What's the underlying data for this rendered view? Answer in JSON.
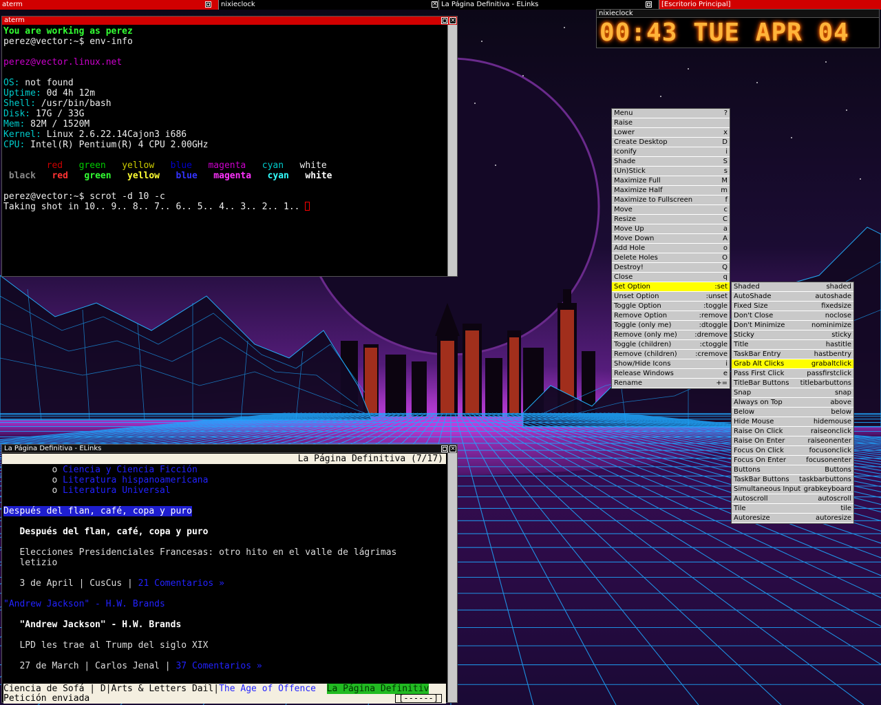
{
  "taskbar": {
    "items": [
      {
        "label": "aterm",
        "state": "active"
      },
      {
        "label": "nixieclock",
        "state": "normal"
      },
      {
        "label": "La Página Definitiva - ELinks",
        "state": "normal"
      },
      {
        "label": "[Escritorio Principal]",
        "state": "active"
      }
    ]
  },
  "aterm": {
    "title": "aterm",
    "welcome": "You are working as perez",
    "prompt1": "perez@vector:~$ env-info",
    "hostline": "perez@vector.linux.net",
    "os_label": "OS:",
    "os_value": " not found",
    "uptime_label": "Uptime:",
    "uptime_value": " 0d 4h 12m",
    "shell_label": "Shell:",
    "shell_value": " /usr/bin/bash",
    "disk_label": "Disk:",
    "disk_value": " 17G / 33G",
    "mem_label": "Mem:",
    "mem_value": " 82M / 1520M",
    "kernel_label": "Kernel:",
    "kernel_value": " Linux 2.6.22.14Cajon3 i686",
    "cpu_label": "CPU:",
    "cpu_value": " Intel(R) Pentium(R) 4 CPU 2.00GHz",
    "colors_normal": [
      "red",
      "green",
      "yellow",
      "blue",
      "magenta",
      "cyan",
      "white"
    ],
    "colors_bold": [
      "black",
      "red",
      "green",
      "yellow",
      "blue",
      "magenta",
      "cyan",
      "white"
    ],
    "prompt2": "perez@vector:~$ scrot -d 10 -c",
    "shot_line": "Taking shot in 10.. 9.. 8.. 7.. 6.. 5.. 4.. 3.. 2.. 1.. "
  },
  "nixieclock": {
    "title": "nixieclock",
    "time": "00:43",
    "day": "TUE",
    "month": "APR",
    "date": "04"
  },
  "window_menu": {
    "items": [
      {
        "label": "Menu",
        "key": "?"
      },
      {
        "label": "Raise",
        "key": ""
      },
      {
        "label": "Lower",
        "key": "x"
      },
      {
        "label": "Create Desktop",
        "key": "D"
      },
      {
        "label": "Iconify",
        "key": "i"
      },
      {
        "label": "Shade",
        "key": "S"
      },
      {
        "label": "(Un)Stick",
        "key": "s"
      },
      {
        "label": "Maximize Full",
        "key": "M"
      },
      {
        "label": "Maximize Half",
        "key": "m"
      },
      {
        "label": "Maximize to Fullscreen",
        "key": "f"
      },
      {
        "label": "Move",
        "key": "c"
      },
      {
        "label": "Resize",
        "key": "C"
      },
      {
        "label": "Move Up",
        "key": "a"
      },
      {
        "label": "Move Down",
        "key": "A"
      },
      {
        "label": "Add Hole",
        "key": "o"
      },
      {
        "label": "Delete Holes",
        "key": "O"
      },
      {
        "label": "Destroy!",
        "key": "Q"
      },
      {
        "label": "Close",
        "key": "q"
      },
      {
        "label": "Set Option",
        "key": ":set",
        "selected": true
      },
      {
        "label": "Unset Option",
        "key": ":unset"
      },
      {
        "label": "Toggle Option",
        "key": ":toggle"
      },
      {
        "label": "Remove Option",
        "key": ":remove"
      },
      {
        "label": "Toggle (only me)",
        "key": ":dtoggle"
      },
      {
        "label": "Remove (only me)",
        "key": ":dremove"
      },
      {
        "label": "Toggle (children)",
        "key": ":ctoggle"
      },
      {
        "label": "Remove (children)",
        "key": ":cremove"
      },
      {
        "label": "Show/Hide Icons",
        "key": "i"
      },
      {
        "label": "Release Windows",
        "key": "e"
      },
      {
        "label": "Rename",
        "key": "+="
      }
    ]
  },
  "options_menu": {
    "items": [
      {
        "label": "Shaded",
        "key": "shaded"
      },
      {
        "label": "AutoShade",
        "key": "autoshade"
      },
      {
        "label": "Fixed Size",
        "key": "fixedsize"
      },
      {
        "label": "Don't Close",
        "key": "noclose"
      },
      {
        "label": "Don't Minimize",
        "key": "nominimize"
      },
      {
        "label": "Sticky",
        "key": "sticky"
      },
      {
        "label": "Title",
        "key": "hastitle"
      },
      {
        "label": "TaskBar Entry",
        "key": "hastbentry"
      },
      {
        "label": "Grab Alt Clicks",
        "key": "grabaltclick",
        "selected": true
      },
      {
        "label": "Pass First Click",
        "key": "passfirstclick"
      },
      {
        "label": "TitleBar Buttons",
        "key": "titlebarbuttons"
      },
      {
        "label": "Snap",
        "key": "snap"
      },
      {
        "label": "Always on Top",
        "key": "above"
      },
      {
        "label": "Below",
        "key": "below"
      },
      {
        "label": "Hide Mouse",
        "key": "hidemouse"
      },
      {
        "label": "Raise On Click",
        "key": "raiseonclick"
      },
      {
        "label": "Raise On Enter",
        "key": "raiseonenter"
      },
      {
        "label": "Focus On Click",
        "key": "focusonclick"
      },
      {
        "label": "Focus On Enter",
        "key": "focusonenter"
      },
      {
        "label": "Buttons",
        "key": "Buttons"
      },
      {
        "label": "TaskBar Buttons",
        "key": "taskbarbuttons"
      },
      {
        "label": "Simultaneous Input",
        "key": "grabkeyboard"
      },
      {
        "label": "Autoscroll",
        "key": "autoscroll"
      },
      {
        "label": "Tile",
        "key": "tile"
      },
      {
        "label": "Autoresize",
        "key": "autoresize"
      }
    ]
  },
  "elinks": {
    "title": "La Página Definitiva - ELinks",
    "header": "La Página Definitiva (7/17)",
    "list": [
      "Ciencia y Ciencia Ficción",
      "Literatura hispanoamericana",
      "Literatura Universal"
    ],
    "bullet": "o",
    "post1_link": "Después del flan, café, copa y puro",
    "post1_title": "Después del flan, café, copa y puro",
    "post1_text1": "Elecciones Presidenciales Francesas: otro hito en el valle de lágrimas",
    "post1_text2": "letizio",
    "post1_meta": "3 de April | CusCus | ",
    "post1_comments": "21 Comentarios »",
    "post2_link": "\"Andrew Jackson\" - H.W. Brands",
    "post2_title": "\"Andrew Jackson\" - H.W. Brands",
    "post2_text": "LPD les trae al Trump del siglo XIX",
    "post2_meta": "27 de March | Carlos Jenal | ",
    "post2_comments": "37 Comentarios »",
    "tabs": [
      "Ciencia de Sofá | D",
      "Arts & Letters Dail",
      "The Age of Offence",
      "La Página Definitiv"
    ],
    "status": "Petición enviada",
    "progress": "[------]"
  },
  "colors": {
    "title_active": "#d10000",
    "menu_bg": "#c9c9c9",
    "menu_selected": "#ffff00",
    "link_blue": "#2222ff",
    "tab_current": "#22bb22",
    "nixie_glow": "#ffb43a"
  }
}
